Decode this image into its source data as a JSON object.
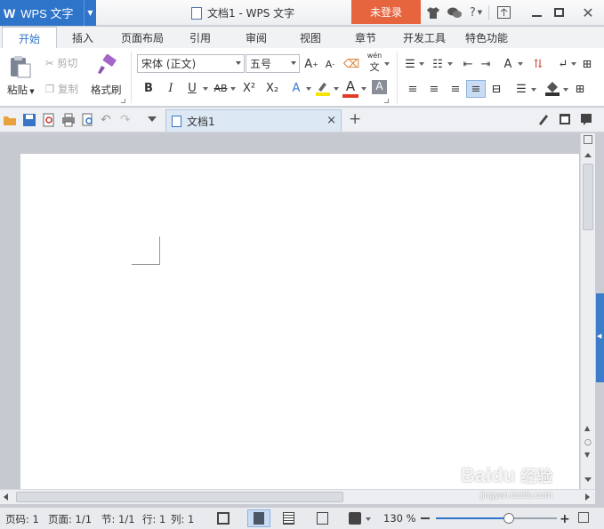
{
  "app": {
    "logo": "W",
    "name": "WPS 文字",
    "window_title": "文档1 - WPS 文字",
    "login": "未登录",
    "help": "?"
  },
  "tabs": [
    "开始",
    "插入",
    "页面布局",
    "引用",
    "审阅",
    "视图",
    "章节",
    "开发工具",
    "特色功能"
  ],
  "clipboard": {
    "paste": "粘贴",
    "cut": "剪切",
    "copy": "复制",
    "format_painter": "格式刷"
  },
  "font": {
    "name": "宋体 (正文)",
    "size": "五号",
    "bold": "B",
    "italic": "I",
    "underline": "U",
    "strike": "AB",
    "superscript": "X²",
    "subscript": "X₂",
    "pinyin": "wén"
  },
  "quickbar": {
    "doc_tab": "文档1",
    "close": "×",
    "new_tab": "+"
  },
  "status": {
    "page_no": "页码: 1",
    "pages": "页面: 1/1",
    "section": "节: 1/1",
    "row": "行: 1",
    "col": "列: 1",
    "zoom": "130 %",
    "zoom_level": 0.6
  },
  "watermark": {
    "brand": "Bai",
    "brand2": "经验",
    "url": "jingyan.baidu.com"
  },
  "colors": {
    "accent": "#2e74c9",
    "login_bg": "#e6653f",
    "font_color": "#e03b2a",
    "highlight": "#f5e400"
  }
}
